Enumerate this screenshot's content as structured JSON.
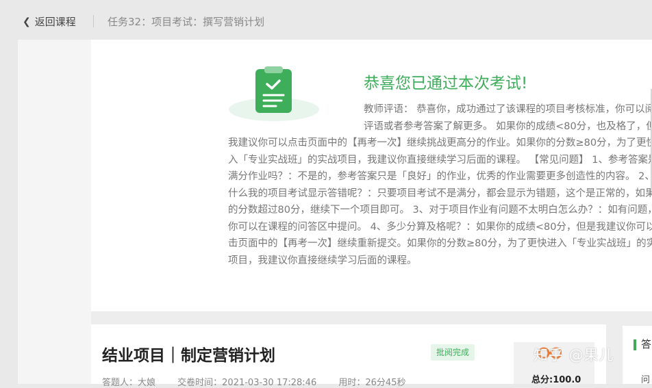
{
  "header": {
    "back_label": "返回课程",
    "breadcrumb": "任务32：项目考试：撰写营销计划"
  },
  "result": {
    "congrats": "恭喜您已通过本次考试!",
    "teacher_comment": "教师评语： 恭喜你，成功通过了该课程的项目考核标准，你可以阅读评语或者参考答案了解更多。 如果你的成绩<80分，也及格了，但是我建议你可以点击页面中的【再考一次】继续挑战更高分的作业。如果你的分数≥80分，为了更快进入「专业实战班」的实战项目，我建议你直接继续学习后面的课程。 【常见问题】 1、参考答案是满分作业吗？：不是的，参考答案只是「良好」的作业，优秀的作业需要更多创造性的内容。 2、为什么我的项目考试显示答错呢？：只要项目考试不是满分，都会显示为错题，这个是正常的，如果你的分数超过80分，继续下一个项目即可。 3、对于项目作业有问题不太明白怎么办？：如有问题，你可以在课程的问答区中提问。 4、多少分算及格呢？：如果你的成绩<80分，但是我建议你可以点击页面中的【再考一次】继续重新提交。如果你的分数≥80分，为了更快进入「专业实战班」的实战项目，我建议你直接继续学习后面的课程。"
  },
  "project": {
    "title": "结业项目｜制定营销计划",
    "status_badge": "批阅完成",
    "answerer": "答题人：大娘",
    "submit_time": "交卷时间：2021-03-30 17:28:46",
    "duration": "用时：26分45秒",
    "total_score": "总分:100.0"
  },
  "right_panel": {
    "title": "答",
    "sub": "问"
  },
  "watermark": "知乎 @果儿",
  "colors": {
    "accent": "#3fae5b",
    "score_icon": "#f07a30"
  },
  "icons": {
    "back": "chevron-left-icon",
    "illustration": "clipboard-check-icon",
    "score": "score-icon"
  }
}
